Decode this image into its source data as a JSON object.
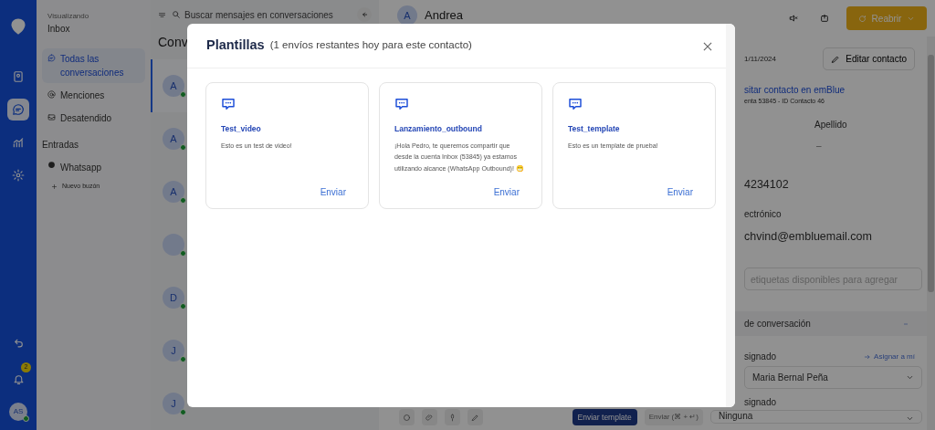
{
  "rail": {
    "badge": "2",
    "avatar": "AS",
    "items": [
      {
        "kind": "contacts",
        "selected": false
      },
      {
        "kind": "chat",
        "selected": true
      },
      {
        "kind": "stats",
        "selected": false
      },
      {
        "kind": "settings",
        "selected": false
      }
    ]
  },
  "sidebar": {
    "caption": "Visualizando",
    "title": "Inbox",
    "items": [
      {
        "label": "Todas las conversaciones",
        "kind": "chat",
        "selected": true
      },
      {
        "label": "Menciones",
        "kind": "at",
        "selected": false
      },
      {
        "label": "Desatendido",
        "kind": "tray",
        "selected": false
      }
    ],
    "section": "Entradas",
    "inboxes": [
      {
        "label": "Whatsapp"
      }
    ],
    "new_inbox": "Nuevo buzón"
  },
  "search": {
    "placeholder": "Buscar mensajes en conversaciones"
  },
  "list": {
    "heading": "Conv",
    "items": [
      {
        "initial": "A",
        "selected": true
      },
      {
        "initial": "A",
        "selected": false
      },
      {
        "initial": "A",
        "selected": false
      },
      {
        "selected": false
      },
      {
        "initial": "D",
        "selected": false
      },
      {
        "initial": "J",
        "selected": false
      },
      {
        "initial": "J",
        "selected": false
      }
    ]
  },
  "chat": {
    "avatar": "A",
    "name": "Andrea",
    "send_template": "Enviar template",
    "send": "Enviar (⌘ + ↵)"
  },
  "header": {
    "reopen": "Reabrir"
  },
  "contact": {
    "date": "1/11/2024",
    "edit": "Editar contacto",
    "link": "sitar contacto en emBlue",
    "account": "enta 53845 - ID Contacto 46",
    "lastname_label": "Apellido",
    "lastname": "–",
    "phone": "4234102",
    "email_label": "ectrónico",
    "email": "chvind@embluemail.com",
    "tags_placeholder": "etiquetas disponibles para agregar",
    "section": "de conversación",
    "assigned_label": "signado",
    "assign_me": "Asignar a mí",
    "assigned": "Maria Bernal Peña",
    "group_label": "signado",
    "group": "Ninguna"
  },
  "modal": {
    "title": "Plantillas",
    "subtitle": "(1 envíos restantes hoy para este contacto)",
    "templates": [
      {
        "name": "Test_video",
        "body": "Esto es un test de video!",
        "action": "Enviar"
      },
      {
        "name": "Lanzamiento_outbound",
        "body": "¡Hola Pedro, te queremos compartir que desde la cuenta Inbox (53845) ya estamos utilizando alcance (WhatsApp Outbound)! 😁",
        "action": "Enviar"
      },
      {
        "name": "Test_template",
        "body": "Esto es un template de prueba!",
        "action": "Enviar"
      }
    ]
  }
}
